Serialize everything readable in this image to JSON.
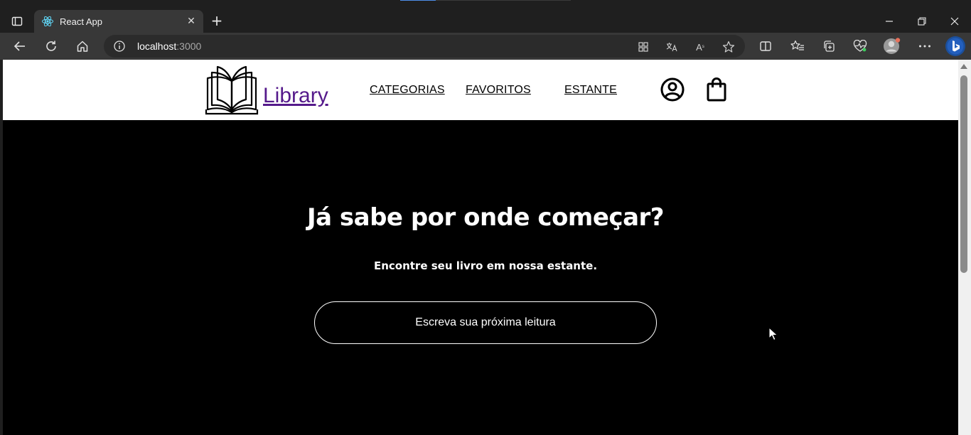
{
  "browser": {
    "tab_title": "React App",
    "url_host": "localhost",
    "url_port": ":3000",
    "new_tab_symbol": "+",
    "close_tab_symbol": "✕",
    "read_aloud_label": "A",
    "accent_color": "#4e8ee8"
  },
  "site": {
    "logo_text": "Library",
    "nav": {
      "categorias": "CATEGORIAS",
      "favoritos": "FAVORITOS",
      "estante": "ESTANTE"
    }
  },
  "hero": {
    "title": "Já sabe por onde começar?",
    "subtitle": "Encontre seu livro em nossa estante.",
    "search_placeholder": "Escreva sua próxima leitura"
  },
  "colors": {
    "page_background": "#000000",
    "header_background": "#ffffff",
    "logo_link": "#551a8b"
  }
}
